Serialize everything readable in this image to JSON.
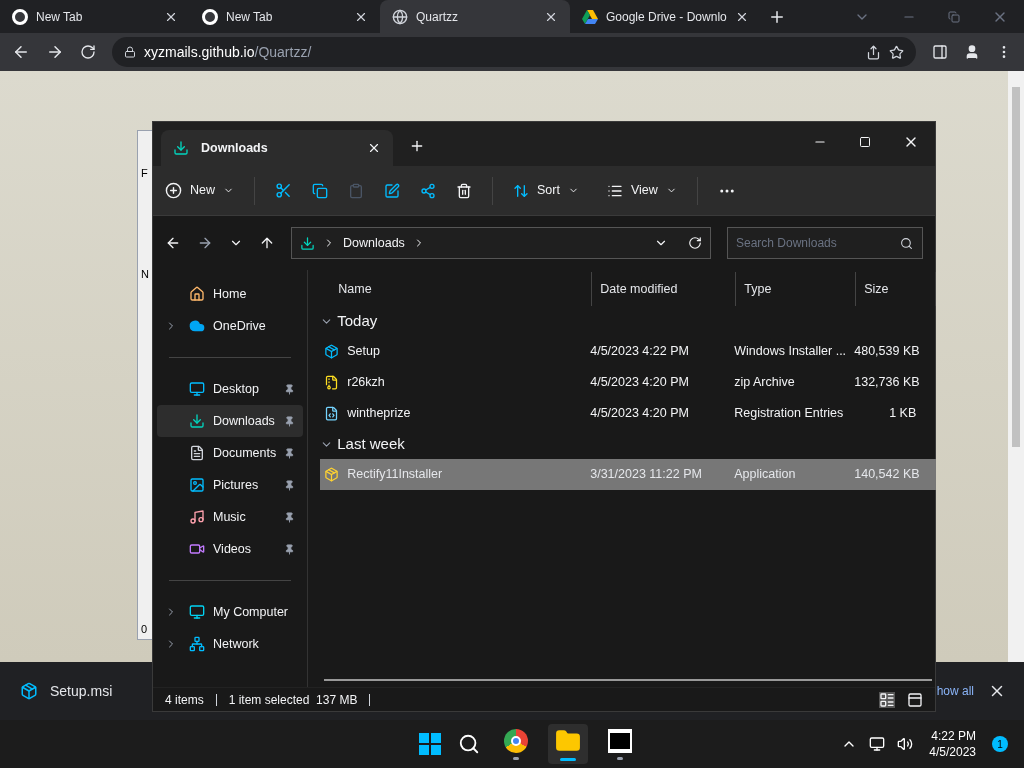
{
  "browser": {
    "tabs": [
      {
        "title": "New Tab",
        "kind": "chrome",
        "selected": false
      },
      {
        "title": "New Tab",
        "kind": "chrome",
        "selected": false
      },
      {
        "title": "Quartzz",
        "kind": "globe",
        "selected": true
      },
      {
        "title": "Google Drive - Downlo",
        "kind": "drive",
        "selected": false
      }
    ],
    "address": {
      "host": "xyzmails.github.io",
      "path": "/Quartzz/"
    }
  },
  "background_window": {
    "texts": [
      "F",
      "N",
      "0"
    ]
  },
  "explorer": {
    "tab_title": "Downloads",
    "toolbar": {
      "new": "New",
      "sort": "Sort",
      "view": "View"
    },
    "breadcrumb": "Downloads",
    "search": {
      "placeholder": "Search Downloads"
    },
    "sidebar": [
      [
        {
          "label": "Home",
          "kind": "home",
          "expandable": false,
          "pinned": false,
          "selected": false
        },
        {
          "label": "OneDrive",
          "kind": "cloud",
          "expandable": true,
          "pinned": false,
          "selected": false
        }
      ],
      [
        {
          "label": "Desktop",
          "kind": "desktop",
          "expandable": false,
          "pinned": true,
          "selected": false
        },
        {
          "label": "Downloads",
          "kind": "download",
          "expandable": false,
          "pinned": true,
          "selected": true
        },
        {
          "label": "Documents",
          "kind": "document",
          "expandable": false,
          "pinned": true,
          "selected": false
        },
        {
          "label": "Pictures",
          "kind": "picture",
          "expandable": false,
          "pinned": true,
          "selected": false
        },
        {
          "label": "Music",
          "kind": "music",
          "expandable": false,
          "pinned": true,
          "selected": false
        },
        {
          "label": "Videos",
          "kind": "video",
          "expandable": false,
          "pinned": true,
          "selected": false
        }
      ],
      [
        {
          "label": "My Computer",
          "kind": "monitor",
          "expandable": true,
          "pinned": false,
          "selected": false
        },
        {
          "label": "Network",
          "kind": "network",
          "expandable": true,
          "pinned": false,
          "selected": false
        }
      ]
    ],
    "columns": [
      "Name",
      "Date modified",
      "Type",
      "Size"
    ],
    "groups": [
      {
        "label": "Today",
        "expanded": true,
        "rows": [
          {
            "name": "Setup",
            "kind": "installer",
            "date": "4/5/2023 4:22 PM",
            "type": "Windows Installer ...",
            "size": "480,539 KB",
            "selected": false
          },
          {
            "name": "r26kzh",
            "kind": "zip",
            "date": "4/5/2023 4:20 PM",
            "type": "zip Archive",
            "size": "132,736 KB",
            "selected": false
          },
          {
            "name": "wintheprize",
            "kind": "registry",
            "date": "4/5/2023 4:20 PM",
            "type": "Registration Entries",
            "size": "1 KB",
            "selected": false
          }
        ]
      },
      {
        "label": "Last week",
        "expanded": true,
        "rows": [
          {
            "name": "Rectify11Installer",
            "kind": "application",
            "date": "3/31/2023 11:22 PM",
            "type": "Application",
            "size": "140,542 KB",
            "selected": true
          }
        ]
      }
    ],
    "status": [
      "4 items",
      "1 item selected  137 MB"
    ]
  },
  "download_bar": {
    "file": "Setup.msi",
    "show_all": "how all"
  },
  "taskbar": {
    "apps": [
      {
        "kind": "chrome",
        "active": false
      },
      {
        "kind": "explorer",
        "active": true
      },
      {
        "kind": "archiver",
        "active": false
      }
    ],
    "time": "4:22 PM",
    "date": "4/5/2023",
    "badge": "1"
  }
}
